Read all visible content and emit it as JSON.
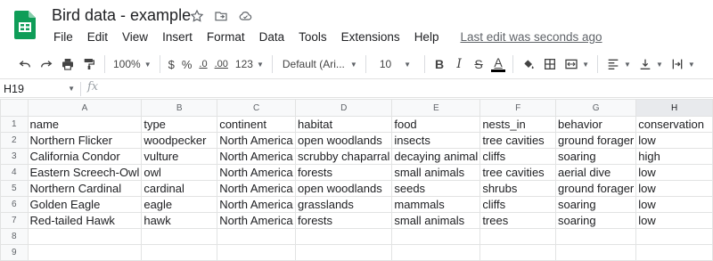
{
  "app": {
    "doc_title": "Bird data - example",
    "last_edit": "Last edit was seconds ago",
    "brand_color": "#0f9d58"
  },
  "menu": [
    "File",
    "Edit",
    "View",
    "Insert",
    "Format",
    "Data",
    "Tools",
    "Extensions",
    "Help"
  ],
  "toolbar": {
    "zoom": "100%",
    "currency": "$",
    "percent": "%",
    "decrease_decimal": ".0",
    "increase_decimal": ".00",
    "more_formats": "123",
    "font_family": "Default (Ari...",
    "font_size": "10",
    "bold": "B",
    "italic": "I",
    "strikethrough": "S",
    "text_color": "A",
    "text_color_swatch": "#000000"
  },
  "formula_bar": {
    "cell_ref": "H19",
    "fx": "fx",
    "content": ""
  },
  "sheet": {
    "columns": [
      "A",
      "B",
      "C",
      "D",
      "E",
      "F",
      "G",
      "H"
    ],
    "selected_column": "H",
    "row_numbers": [
      "1",
      "2",
      "3",
      "4",
      "5",
      "6",
      "7",
      "8",
      "9"
    ],
    "rows": [
      [
        "name",
        "type",
        "continent",
        "habitat",
        "food",
        "nests_in",
        "behavior",
        "conservation"
      ],
      [
        "Northern Flicker",
        "woodpecker",
        "North America",
        "open woodlands",
        "insects",
        "tree cavities",
        "ground forager",
        "low"
      ],
      [
        "California Condor",
        "vulture",
        "North America",
        "scrubby chaparral",
        "decaying animal",
        "cliffs",
        "soaring",
        "high"
      ],
      [
        "Eastern Screech-Owl",
        "owl",
        "North America",
        "forests",
        "small animals",
        "tree cavities",
        "aerial dive",
        "low"
      ],
      [
        "Northern Cardinal",
        "cardinal",
        "North America",
        "open woodlands",
        "seeds",
        "shrubs",
        "ground forager",
        "low"
      ],
      [
        "Golden Eagle",
        "eagle",
        "North America",
        "grasslands",
        "mammals",
        "cliffs",
        "soaring",
        "low"
      ],
      [
        "Red-tailed Hawk",
        "hawk",
        "North America",
        "forests",
        "small animals",
        "trees",
        "soaring",
        "low"
      ],
      [
        "",
        "",
        "",
        "",
        "",
        "",
        "",
        ""
      ],
      [
        "",
        "",
        "",
        "",
        "",
        "",
        "",
        ""
      ]
    ]
  }
}
